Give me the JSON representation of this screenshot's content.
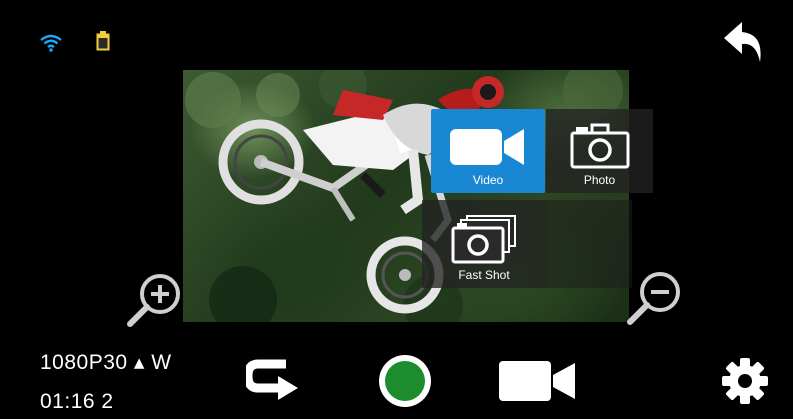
{
  "status": {
    "wifi_icon": "wifi-icon",
    "battery_icon": "battery-icon"
  },
  "mode_menu": {
    "items": [
      {
        "label": "Video",
        "icon": "video-camera-icon",
        "selected": true
      },
      {
        "label": "Photo",
        "icon": "photo-camera-icon",
        "selected": false
      },
      {
        "label": "Fast Shot",
        "icon": "fast-shot-icon",
        "selected": false
      }
    ]
  },
  "info": {
    "resolution": "1080P30 ▴ W",
    "time": "01:16 2"
  },
  "colors": {
    "accent_blue": "#1a87d5",
    "record_green": "#1c8c2c",
    "background": "#000000"
  }
}
